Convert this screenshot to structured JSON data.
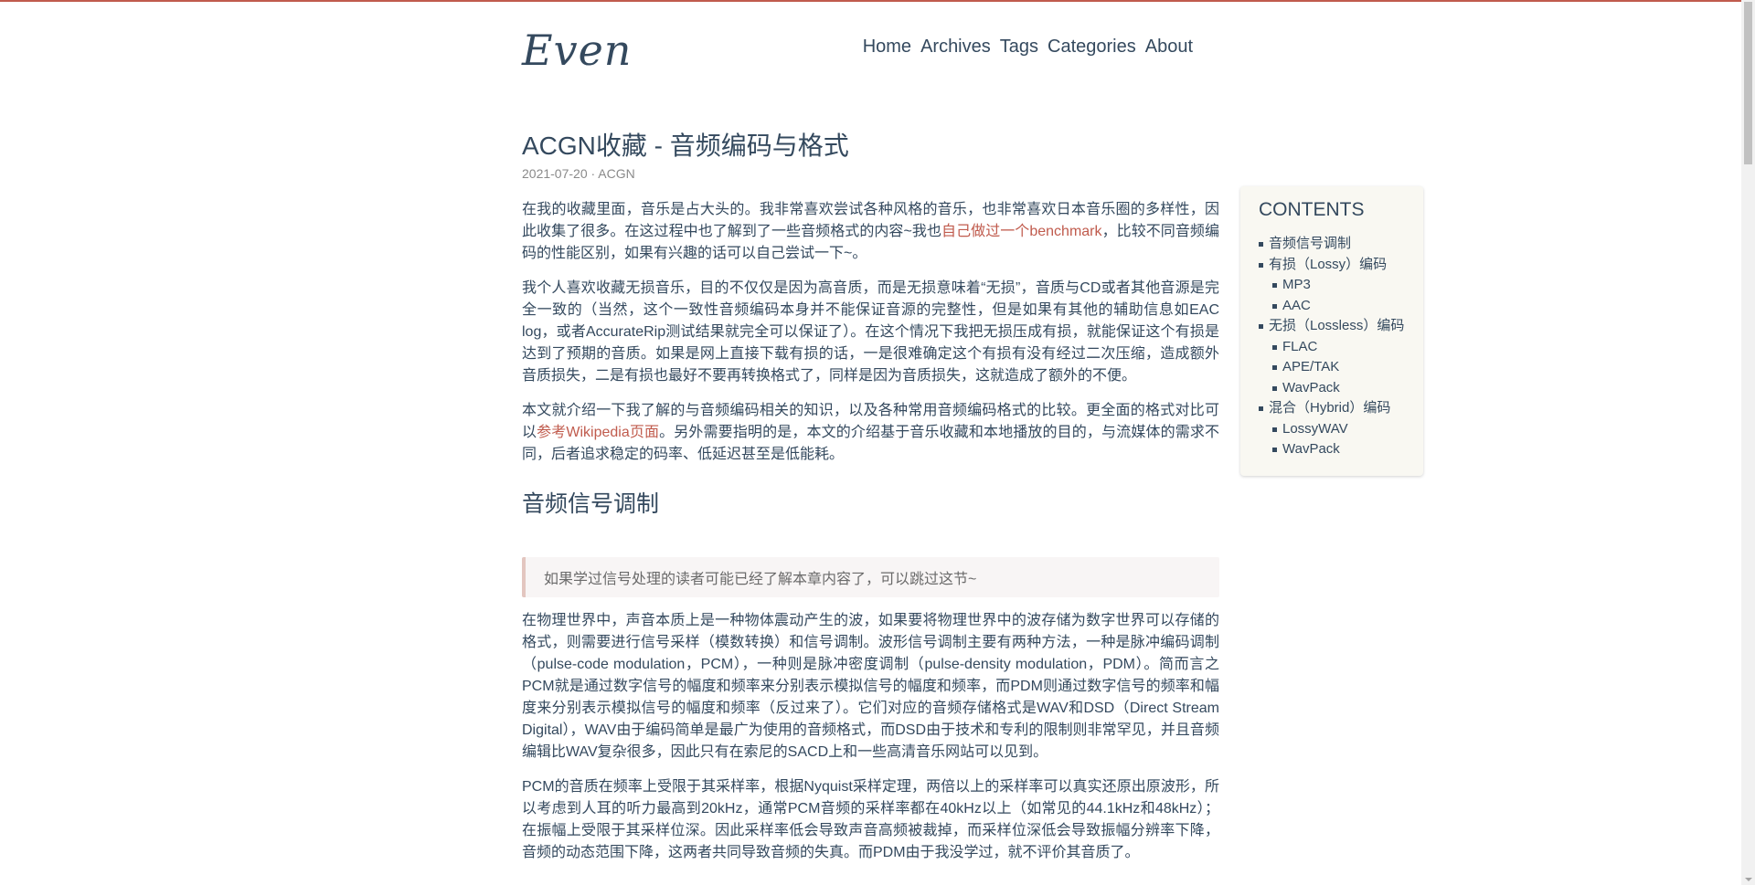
{
  "site": {
    "logo": "Even"
  },
  "nav": [
    "Home",
    "Archives",
    "Tags",
    "Categories",
    "About"
  ],
  "post": {
    "title": "ACGN收藏 - 音频编码与格式",
    "date": "2021-07-20",
    "meta_sep": " · ",
    "category": "ACGN",
    "p1_a": "在我的收藏里面，音乐是占大头的。我非常喜欢尝试各种风格的音乐，也非常喜欢日本音乐圈的多样性，因此收集了很多。在这过程中也了解到了一些音频格式的内容~我也",
    "p1_link": "自己做过一个benchmark",
    "p1_b": "，比较不同音频编码的性能区别，如果有兴趣的话可以自己尝试一下~。",
    "p2": "我个人喜欢收藏无损音乐，目的不仅仅是因为高音质，而是无损意味着“无损”，音质与CD或者其他音源是完全一致的（当然，这个一致性音频编码本身并不能保证音源的完整性，但是如果有其他的辅助信息如EAC log，或者AccurateRip测试结果就完全可以保证了）。在这个情况下我把无损压成有损，就能保证这个有损是达到了预期的音质。如果是网上直接下载有损的话，一是很难确定这个有损有没有经过二次压缩，造成额外音质损失，二是有损也最好不要再转换格式了，同样是因为音质损失，这就造成了额外的不便。",
    "p3_a": "本文就介绍一下我了解的与音频编码相关的知识，以及各种常用音频编码格式的比较。更全面的格式对比可以",
    "p3_link": "参考Wikipedia页面",
    "p3_b": "。另外需要指明的是，本文的介绍基于音乐收藏和本地播放的目的，与流媒体的需求不同，后者追求稳定的码率、低延迟甚至是低能耗。",
    "h2": "音频信号调制",
    "quote": "如果学过信号处理的读者可能已经了解本章内容了，可以跳过这节~",
    "p4": "在物理世界中，声音本质上是一种物体震动产生的波，如果要将物理世界中的波存储为数字世界可以存储的格式，则需要进行信号采样（模数转换）和信号调制。波形信号调制主要有两种方法，一种是脉冲编码调制（pulse-code modulation，PCM），一种则是脉冲密度调制（pulse-density modulation，PDM）。简而言之PCM就是通过数字信号的幅度和频率来分别表示模拟信号的幅度和频率，而PDM则通过数字信号的频率和幅度来分别表示模拟信号的幅度和频率（反过来了）。它们对应的音频存储格式是WAV和DSD（Direct Stream Digital），WAV由于编码简单是最广为使用的音频格式，而DSD由于技术和专利的限制则非常罕见，并且音频编辑比WAV复杂很多，因此只有在索尼的SACD上和一些高清音乐网站可以见到。",
    "p5": "PCM的音质在频率上受限于其采样率，根据Nyquist采样定理，两倍以上的采样率可以真实还原出原波形，所以考虑到人耳的听力最高到20kHz，通常PCM音频的采样率都在40kHz以上（如常见的44.1kHz和48kHz）；在振幅上受限于其采样位深。因此采样率低会导致声音高频被裁掉，而采样位深低会导致振幅分辨率下降，音频的动态范围下降，这两者共同导致音频的失真。而PDM由于我没学过，就不评价其音质了。"
  },
  "toc": {
    "title": "CONTENTS",
    "items": [
      {
        "label": "音频信号调制",
        "level": 1
      },
      {
        "label": "有损（Lossy）编码",
        "level": 1
      },
      {
        "label": "MP3",
        "level": 2
      },
      {
        "label": "AAC",
        "level": 2
      },
      {
        "label": "无损（Lossless）编码",
        "level": 1
      },
      {
        "label": "FLAC",
        "level": 2
      },
      {
        "label": "APE/TAK",
        "level": 2
      },
      {
        "label": "WavPack",
        "level": 2
      },
      {
        "label": "混合（Hybrid）编码",
        "level": 1
      },
      {
        "label": "LossyWAV",
        "level": 2
      },
      {
        "label": "WavPack",
        "level": 2
      }
    ]
  },
  "colors": {
    "accent": "#c05b4d",
    "text": "#34495e",
    "toc_bg": "#f9f8f2"
  }
}
